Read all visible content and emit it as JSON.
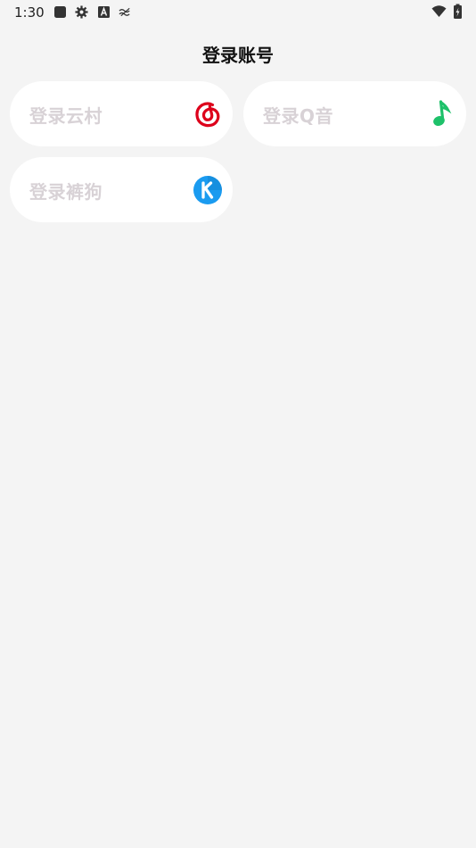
{
  "status_bar": {
    "time": "1:30",
    "left_icons": [
      "app-square-icon",
      "gear-icon",
      "font-a-icon",
      "signal-wave-icon"
    ],
    "right_icons": [
      "wifi-icon",
      "battery-charging-icon"
    ]
  },
  "header": {
    "title": "登录账号"
  },
  "login_options": [
    {
      "label": "登录云村",
      "icon": "netease-cloud-music-icon",
      "accent": "#dd001b"
    },
    {
      "label": "登录Q音",
      "icon": "qq-music-icon",
      "accent": "#1ec16a"
    },
    {
      "label": "登录裤狗",
      "icon": "kugou-icon",
      "accent": "#1a9bf0"
    }
  ],
  "colors": {
    "background": "#f4f4f4",
    "card": "#ffffff",
    "label": "#d8d2d6"
  }
}
